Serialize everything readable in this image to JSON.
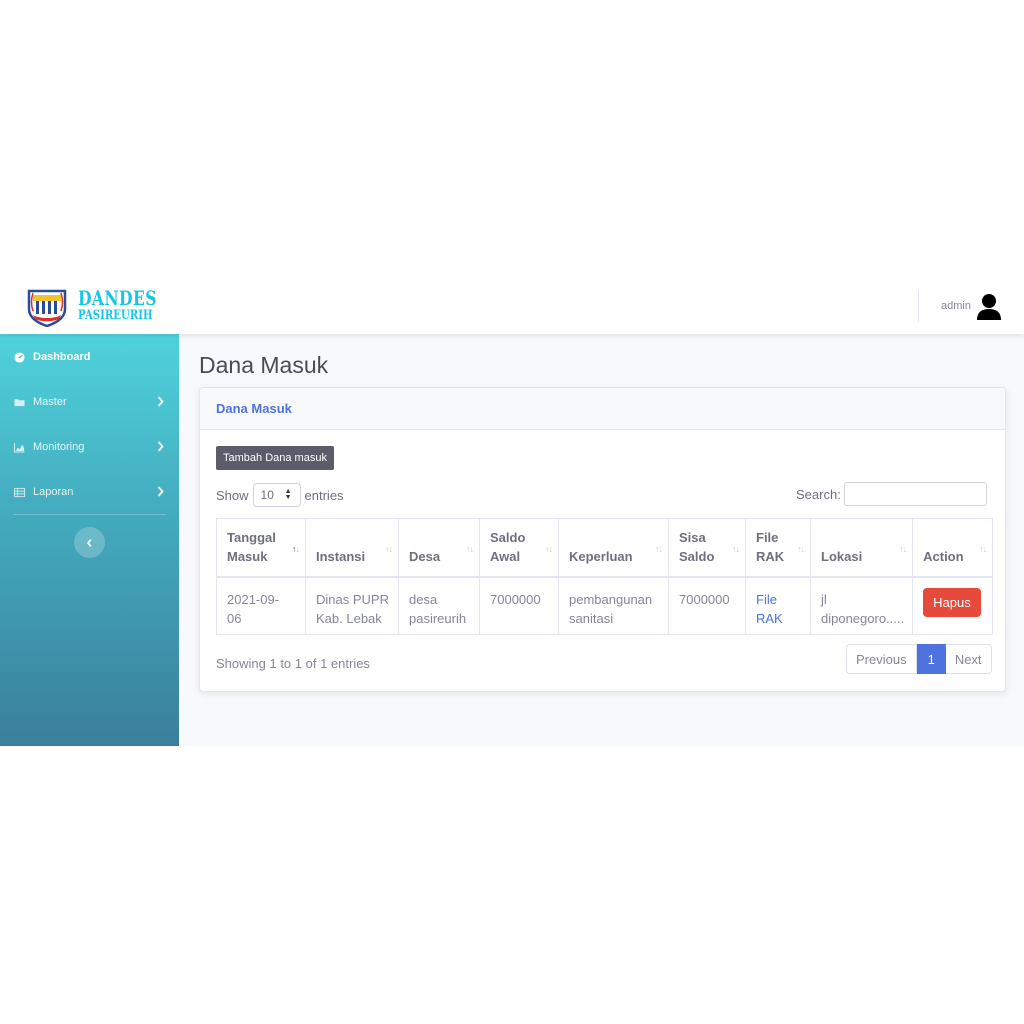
{
  "header": {
    "brand_line1": "DANDES",
    "brand_line2": "PASIREURIH",
    "user_name": "admin",
    "brand_color": "#17c6e6"
  },
  "sidebar": {
    "items": [
      {
        "label": "Dashboard",
        "icon": "tachometer-icon",
        "active": true
      },
      {
        "label": "Master",
        "icon": "folder-icon",
        "expandable": true
      },
      {
        "label": "Monitoring",
        "icon": "area-chart-icon",
        "expandable": true
      },
      {
        "label": "Laporan",
        "icon": "table-icon",
        "expandable": true
      }
    ],
    "toggle_icon": "chevron-left-icon"
  },
  "page": {
    "title": "Dana Masuk"
  },
  "card": {
    "title": "Dana Masuk",
    "add_button": "Tambah Dana masuk",
    "show_label": "Show",
    "entries_label": "entries",
    "page_length": "10",
    "search_label": "Search:",
    "search_value": ""
  },
  "table": {
    "columns": [
      {
        "line1": "Tanggal",
        "line2": "Masuk",
        "sorted": "asc"
      },
      {
        "line1": "",
        "line2": "Instansi"
      },
      {
        "line1": "",
        "line2": "Desa"
      },
      {
        "line1": "Saldo",
        "line2": "Awal"
      },
      {
        "line1": "",
        "line2": "Keperluan"
      },
      {
        "line1": "Sisa",
        "line2": "Saldo"
      },
      {
        "line1": "File",
        "line2": "RAK"
      },
      {
        "line1": "",
        "line2": "Lokasi"
      },
      {
        "line1": "",
        "line2": "Action"
      }
    ],
    "rows": [
      {
        "tanggal": [
          "2021-09-",
          "06"
        ],
        "instansi": [
          "Dinas PUPR",
          "Kab. Lebak"
        ],
        "desa": [
          "desa",
          "pasireurih"
        ],
        "saldo_awal": "7000000",
        "keperluan": [
          "pembangunan",
          "sanitasi"
        ],
        "sisa_saldo": "7000000",
        "file_rak": [
          "File",
          "RAK"
        ],
        "lokasi": [
          "jl",
          "diponegoro....."
        ],
        "action": "Hapus"
      }
    ]
  },
  "footer": {
    "info": "Showing 1 to 1 of 1 entries",
    "previous": "Previous",
    "current_page": "1",
    "next": "Next"
  },
  "colors": {
    "primary": "#4e73df",
    "danger": "#e74a3b",
    "sidebar_top": "#4fd2dc",
    "sidebar_bottom": "#3a7f9c"
  }
}
